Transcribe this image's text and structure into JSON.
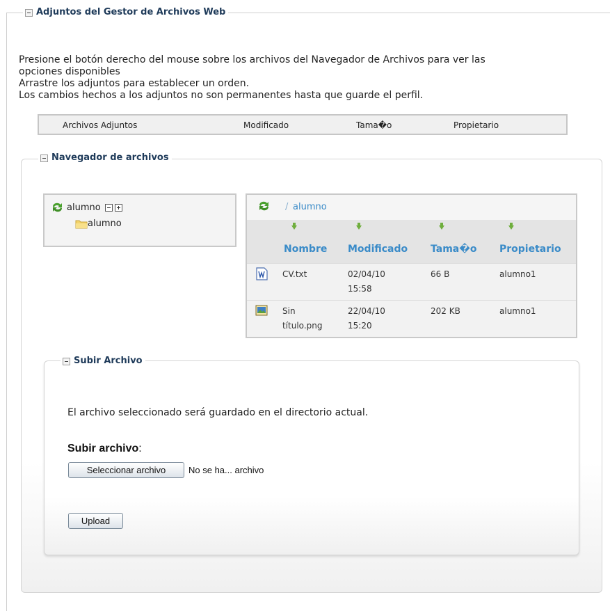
{
  "attachments": {
    "legend": "Adjuntos del Gestor de Archivos Web",
    "instructions": [
      "Presione el botón derecho del mouse sobre los archivos del Navegador de Archivos para ver las",
      "opciones disponibles",
      "Arrastre los adjuntos para establecer un orden.",
      "Los cambios hechos a los adjuntos no son permanentes hasta que guarde el perfil."
    ],
    "columns": [
      "Archivos Adjuntos",
      "Modificado",
      "Tama�o",
      "Propietario"
    ]
  },
  "navigator": {
    "legend": "Navegador de archivos",
    "tree": {
      "root_label": "alumno",
      "child_label": "alumno"
    },
    "files": {
      "path_separator": "/",
      "path": "alumno",
      "columns": [
        "Nombre",
        "Modificado",
        "Tama�o",
        "Propietario"
      ],
      "rows": [
        {
          "name_line1": "CV.txt",
          "name_line2": "",
          "modified_line1": "02/04/10",
          "modified_line2": "15:58",
          "size": "66 B",
          "owner": "alumno1",
          "icon": "text-file-icon"
        },
        {
          "name_line1": "Sin",
          "name_line2": "título.png",
          "modified_line1": "22/04/10",
          "modified_line2": "15:20",
          "size": "202 KB",
          "owner": "alumno1",
          "icon": "image-file-icon"
        }
      ]
    }
  },
  "upload": {
    "legend": "Subir Archivo",
    "description": "El archivo seleccionado será guardado en el directorio actual.",
    "field_label": "Subir archivo",
    "colon": ":",
    "choose_button": "Seleccionar archivo",
    "no_file_text": "No se ha... archivo",
    "upload_button": "Upload"
  },
  "colors": {
    "legend_text": "#1f3b5a",
    "link_blue": "#3a8bc8",
    "arrow_green": "#6fae3d"
  }
}
